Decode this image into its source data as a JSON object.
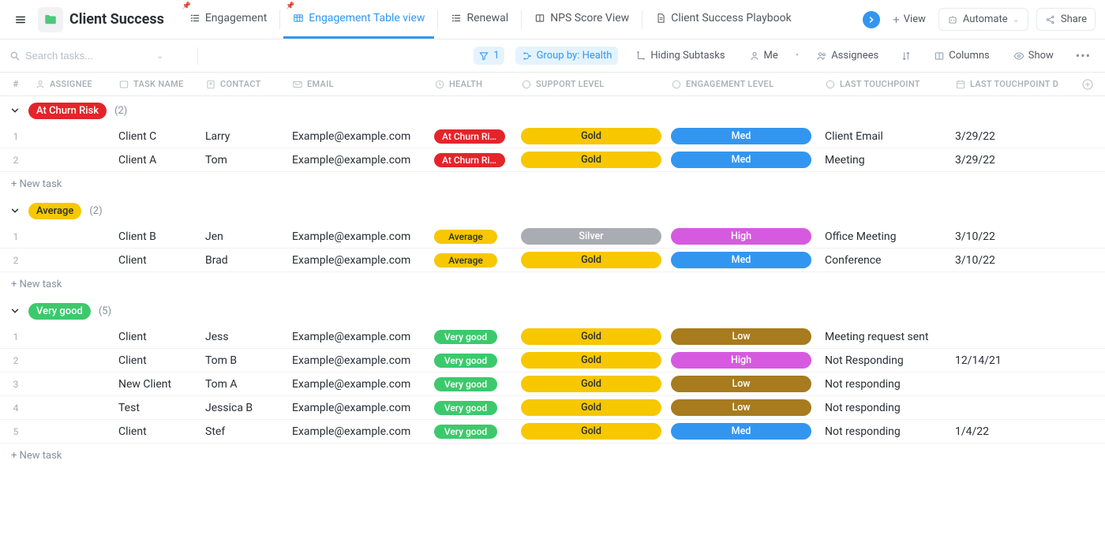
{
  "header": {
    "title": "Client Success",
    "tabs": [
      {
        "label": "Engagement"
      },
      {
        "label": "Engagement Table view",
        "active": true
      },
      {
        "label": "Renewal"
      },
      {
        "label": "NPS Score View"
      },
      {
        "label": "Client Success Playbook"
      }
    ],
    "addView": "View",
    "automate": "Automate",
    "share": "Share"
  },
  "toolbar": {
    "searchPlaceholder": "Search tasks...",
    "filterCount": "1",
    "groupBy": "Group by: Health",
    "subtasks": "Hiding Subtasks",
    "me": "Me",
    "assignees": "Assignees",
    "columns": "Columns",
    "show": "Show"
  },
  "columns": {
    "num": "#",
    "assignee": "ASSIGNEE",
    "task": "TASK NAME",
    "contact": "CONTACT",
    "email": "EMAIL",
    "health": "HEALTH",
    "support": "SUPPORT LEVEL",
    "engagement": "ENGAGEMENT LEVEL",
    "touchpoint": "LAST TOUCHPOINT",
    "touchdate": "LAST TOUCHPOINT D"
  },
  "newTask": "+ New task",
  "groups": [
    {
      "name": "At Churn Risk",
      "badgeClass": "red",
      "count": "(2)",
      "rows": [
        {
          "task": "Client C",
          "contact": "Larry",
          "email": "Example@example.com",
          "health": "At Churn Ri...",
          "healthClass": "red",
          "support": "Gold",
          "supportClass": "gold",
          "engagement": "Med",
          "engagementClass": "blue",
          "touchpoint": "Client Email",
          "touchdate": "3/29/22"
        },
        {
          "task": "Client A",
          "contact": "Tom",
          "email": "Example@example.com",
          "health": "At Churn Ri...",
          "healthClass": "red",
          "support": "Gold",
          "supportClass": "gold",
          "engagement": "Med",
          "engagementClass": "blue",
          "touchpoint": "Meeting",
          "touchdate": "3/29/22"
        }
      ]
    },
    {
      "name": "Average",
      "badgeClass": "yellow",
      "count": "(2)",
      "rows": [
        {
          "task": "Client B",
          "contact": "Jen",
          "email": "Example@example.com",
          "health": "Average",
          "healthClass": "yellow",
          "support": "Silver",
          "supportClass": "silver",
          "engagement": "High",
          "engagementClass": "pink",
          "touchpoint": "Office Meeting",
          "touchdate": "3/10/22"
        },
        {
          "task": "Client",
          "contact": "Brad",
          "email": "Example@example.com",
          "health": "Average",
          "healthClass": "yellow",
          "support": "Gold",
          "supportClass": "gold",
          "engagement": "Med",
          "engagementClass": "blue",
          "touchpoint": "Conference",
          "touchdate": "3/10/22"
        }
      ]
    },
    {
      "name": "Very good",
      "badgeClass": "green",
      "count": "(5)",
      "rows": [
        {
          "task": "Client",
          "contact": "Jess",
          "email": "Example@example.com",
          "health": "Very good",
          "healthClass": "green",
          "support": "Gold",
          "supportClass": "gold",
          "engagement": "Low",
          "engagementClass": "brown",
          "touchpoint": "Meeting request sent",
          "touchdate": ""
        },
        {
          "task": "Client",
          "contact": "Tom B",
          "email": "Example@example.com",
          "health": "Very good",
          "healthClass": "green",
          "support": "Gold",
          "supportClass": "gold",
          "engagement": "High",
          "engagementClass": "pink",
          "touchpoint": "Not Responding",
          "touchdate": "12/14/21"
        },
        {
          "task": "New Client",
          "contact": "Tom A",
          "email": "Example@example.com",
          "health": "Very good",
          "healthClass": "green",
          "support": "Gold",
          "supportClass": "gold",
          "engagement": "Low",
          "engagementClass": "brown",
          "touchpoint": "Not responding",
          "touchdate": ""
        },
        {
          "task": "Test",
          "contact": "Jessica B",
          "email": "Example@example.com",
          "health": "Very good",
          "healthClass": "green",
          "support": "Gold",
          "supportClass": "gold",
          "engagement": "Low",
          "engagementClass": "brown",
          "touchpoint": "Not responding",
          "touchdate": ""
        },
        {
          "task": "Client",
          "contact": "Stef",
          "email": "Example@example.com",
          "health": "Very good",
          "healthClass": "green",
          "support": "Gold",
          "supportClass": "gold",
          "engagement": "Med",
          "engagementClass": "blue",
          "touchpoint": "Not responding",
          "touchdate": "1/4/22"
        }
      ]
    }
  ]
}
